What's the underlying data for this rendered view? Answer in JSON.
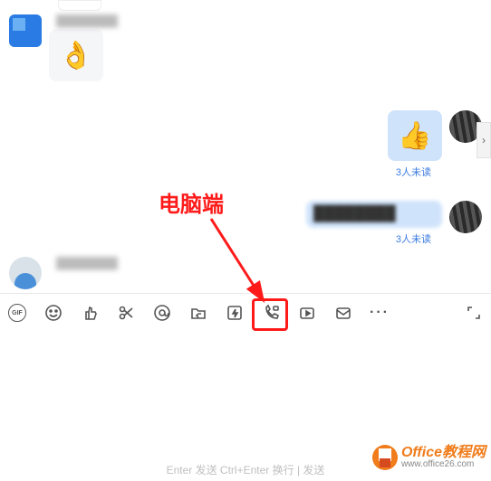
{
  "messages": {
    "m1": {
      "sender": "████████",
      "sticker": "👌"
    },
    "m2": {
      "sticker": "👍",
      "unread": "3人未读"
    },
    "m3": {
      "text_blurred": "████████",
      "unread": "3人未读"
    },
    "m4": {
      "sender": "████████"
    }
  },
  "annotation": {
    "label": "电脑端"
  },
  "side_arrow": {
    "glyph": "›"
  },
  "toolbar": {
    "gif_label": "GIF",
    "more_glyph": "···"
  },
  "hint": "Enter 发送   Ctrl+Enter 换行    |   发送",
  "watermark": {
    "title": "Office教程网",
    "url": "www.office26.com"
  }
}
